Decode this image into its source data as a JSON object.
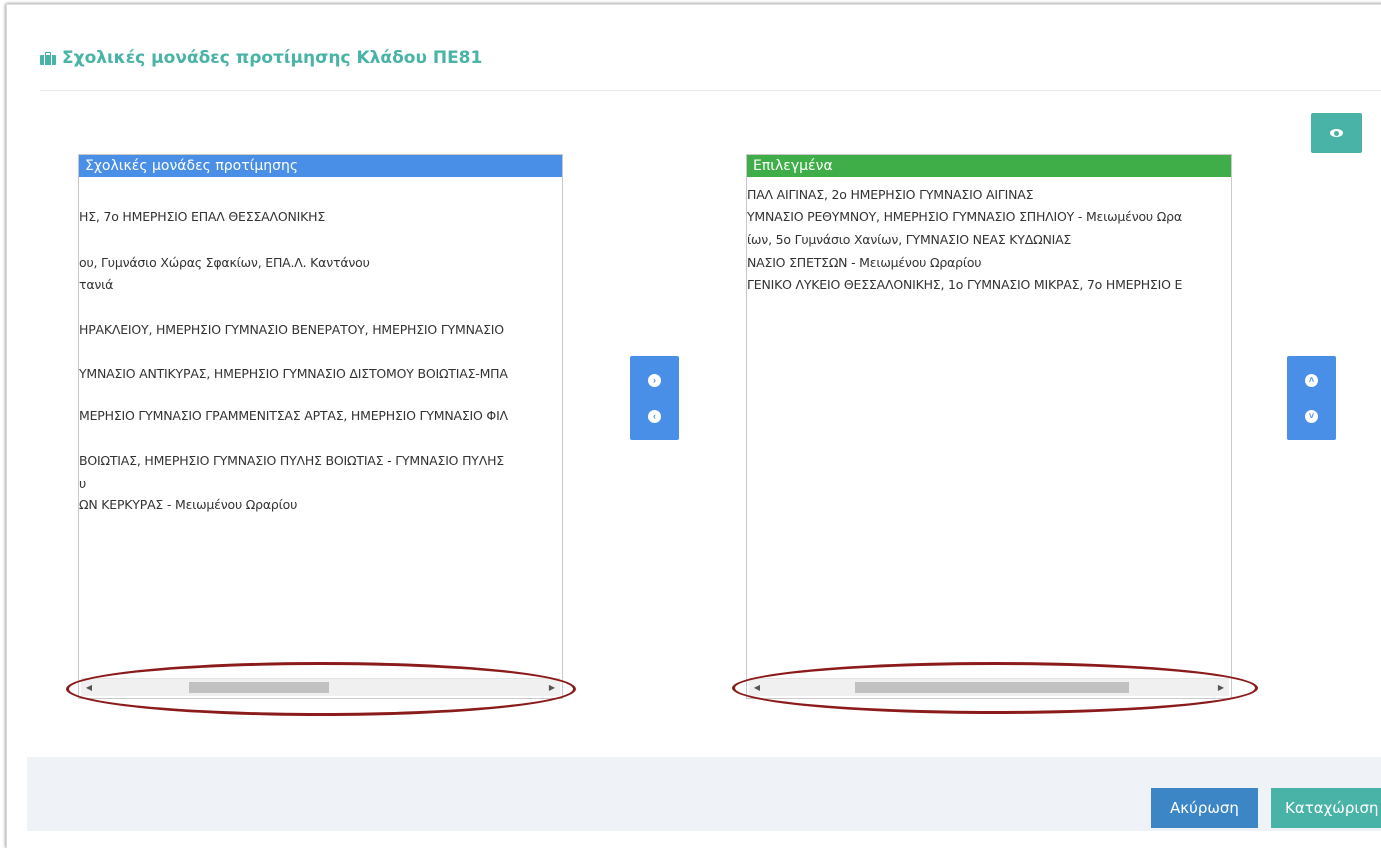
{
  "modal": {
    "title": "Σχολικές μονάδες προτίμησης Κλάδου ΠΕ81",
    "title_icon": "briefcase-icon",
    "accent_color": "#48b3a6"
  },
  "left_list": {
    "header": "Σχολικές μονάδες προτίμησης",
    "header_color": "#4a8fe7",
    "rows": [
      "ΗΣ, 7ο ΗΜΕΡΗΣΙΟ ΕΠΑΛ ΘΕΣΣΑΛΟΝΙΚΗΣ",
      "ου, Γυμνάσιο Χώρας Σφακίων, ΕΠΑ.Λ. Καντάνου",
      "τανιά",
      "ΗΡΑΚΛΕΙΟΥ, ΗΜΕΡΗΣΙΟ ΓΥΜΝΑΣΙΟ ΒΕΝΕΡΑΤΟΥ, ΗΜΕΡΗΣΙΟ ΓΥΜΝΑΣΙΟ",
      "ΥΜΝΑΣΙΟ ΑΝΤΙΚΥΡΑΣ, ΗΜΕΡΗΣΙΟ ΓΥΜΝΑΣΙΟ ΔΙΣΤΟΜΟΥ ΒΟΙΩΤΙΑΣ-ΜΠΑ",
      "ΜΕΡΗΣΙΟ ΓΥΜΝΑΣΙΟ ΓΡΑΜΜΕΝΙΤΣΑΣ ΑΡΤΑΣ, ΗΜΕΡΗΣΙΟ ΓΥΜΝΑΣΙΟ ΦΙΛ",
      "ΒΟΙΩΤΙΑΣ, ΗΜΕΡΗΣΙΟ ΓΥΜΝΑΣΙΟ ΠΥΛΗΣ ΒΟΙΩΤΙΑΣ - ΓΥΜΝΑΣΙΟ ΠΥΛΗΣ",
      "υ",
      "ΩΝ ΚΕΡΚΥΡΑΣ - Μειωμένου Ωραρίου"
    ]
  },
  "right_list": {
    "header": "Επιλεγμένα",
    "header_color": "#3fae49",
    "rows": [
      "ΠΑΛ ΑΙΓΙΝΑΣ, 2ο ΗΜΕΡΗΣΙΟ ΓΥΜΝΑΣΙΟ ΑΙΓΙΝΑΣ",
      "ΥΜΝΑΣΙΟ ΡΕΘΥΜΝΟΥ, ΗΜΕΡΗΣΙΟ ΓΥΜΝΑΣΙΟ ΣΠΗΛΙΟΥ - Μειωμένου Ωρα",
      "ίων, 5ο Γυμνάσιο Χανίων, ΓΥΜΝΑΣΙΟ ΝΕΑΣ ΚΥΔΩΝΙΑΣ",
      "ΝΑΣΙΟ ΣΠΕΤΣΩΝ - Μειωμένου Ωραρίου",
      "ΓΕΝΙΚΟ ΛΥΚΕΙΟ ΘΕΣΣΑΛΟΝΙΚΗΣ, 1ο ΓΥΜΝΑΣΙΟ ΜΙΚΡΑΣ, 7ο ΗΜΕΡΗΣΙΟ Ε"
    ]
  },
  "controls": {
    "eye_icon": "eye-icon",
    "move_right_icon": "chevron-right-icon",
    "move_left_icon": "chevron-left-icon",
    "move_up_icon": "chevron-up-icon",
    "move_down_icon": "chevron-down-icon",
    "button_color": "#4a8fe7"
  },
  "footer": {
    "cancel_label": "Ακύρωση",
    "submit_label": "Καταχώριση",
    "cancel_color": "#3d86c6",
    "submit_color": "#48b3a6"
  },
  "annotation": {
    "highlight_color": "#8b1a1a"
  }
}
